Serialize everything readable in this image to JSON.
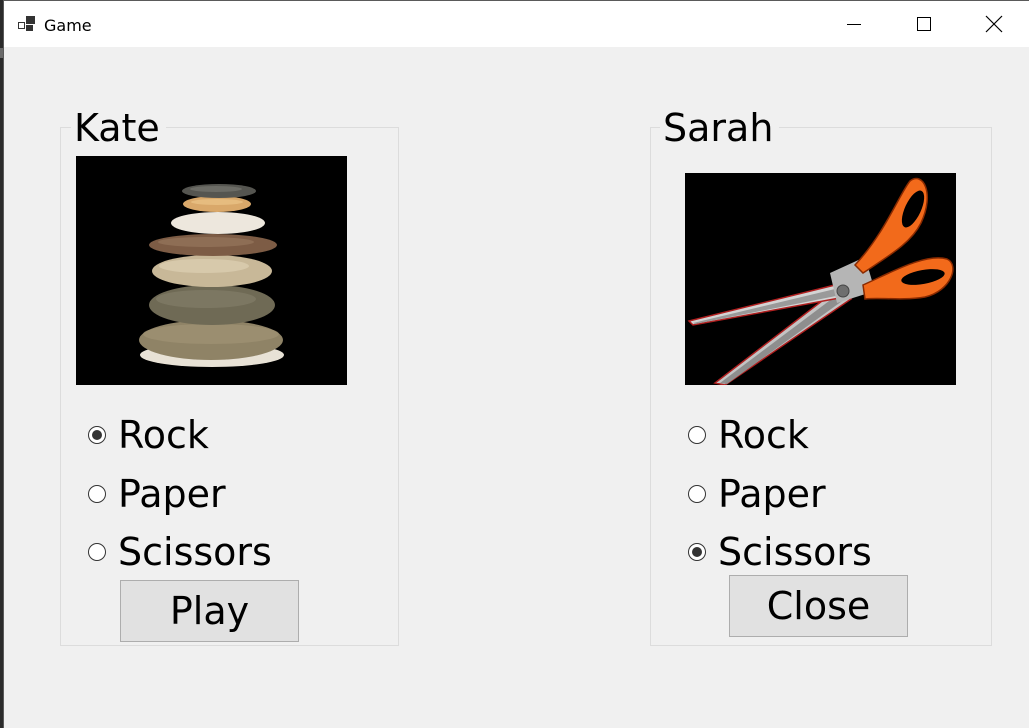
{
  "window": {
    "title": "Game",
    "icon": "app-window-icon",
    "controls": {
      "minimize_icon": "minimize-icon",
      "maximize_icon": "maximize-icon",
      "close_icon": "close-icon"
    }
  },
  "players": [
    {
      "name": "Kate",
      "image": "rock-stack-image",
      "options": [
        {
          "label": "Rock",
          "checked": true
        },
        {
          "label": "Paper",
          "checked": false
        },
        {
          "label": "Scissors",
          "checked": false
        }
      ],
      "button_label": "Play"
    },
    {
      "name": "Sarah",
      "image": "scissors-image",
      "options": [
        {
          "label": "Rock",
          "checked": false
        },
        {
          "label": "Paper",
          "checked": false
        },
        {
          "label": "Scissors",
          "checked": true
        }
      ],
      "button_label": "Close"
    }
  ],
  "colors": {
    "window_bg": "#f0f0f0",
    "titlebar_bg": "#ffffff",
    "button_bg": "#e1e1e1",
    "scissors_handle": "#f26a1b"
  }
}
